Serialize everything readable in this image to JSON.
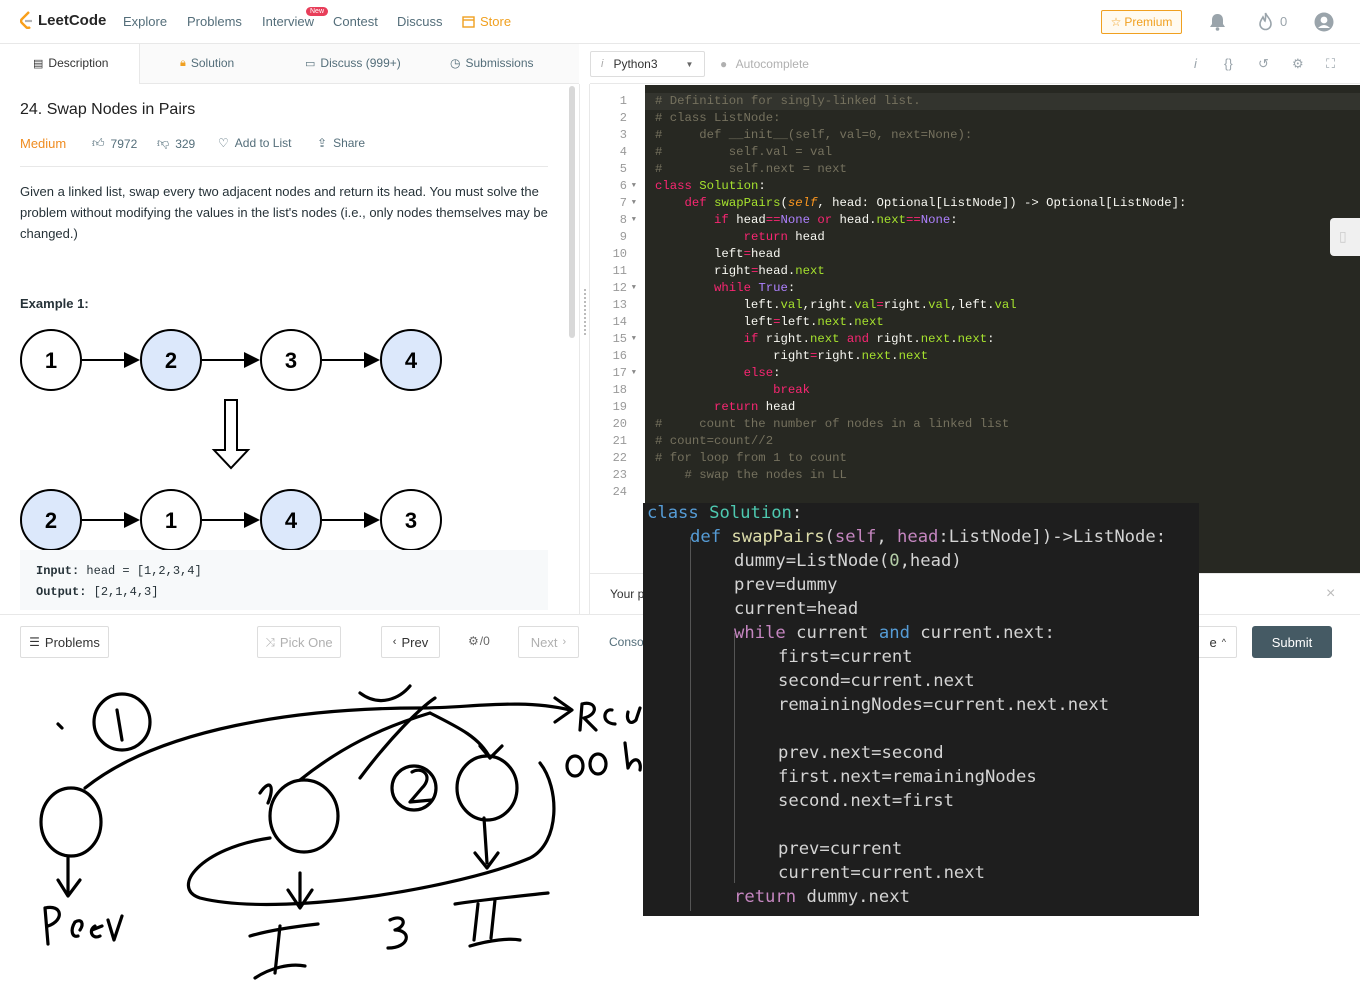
{
  "nav": {
    "logo": "LeetCode",
    "links": [
      "Explore",
      "Problems",
      "Interview",
      "Contest",
      "Discuss",
      "Store"
    ],
    "new_badge": "New",
    "premium": "Premium",
    "coins": "0"
  },
  "left_tabs": {
    "description": "Description",
    "solution": "Solution",
    "discuss": "Discuss (999+)",
    "submissions": "Submissions"
  },
  "problem": {
    "title": "24. Swap Nodes in Pairs",
    "difficulty": "Medium",
    "likes": "7972",
    "dislikes": "329",
    "add_to_list": "Add to List",
    "share": "Share",
    "description": "Given a linked list, swap every two adjacent nodes and return its head. You must solve the problem without modifying the values in the list's nodes (i.e., only nodes themselves may be changed.)",
    "example_title": "Example 1:",
    "diagram_top": [
      "1",
      "2",
      "3",
      "4"
    ],
    "diagram_bottom": [
      "2",
      "1",
      "4",
      "3"
    ],
    "input_label": "Input:",
    "input_value": "head = [1,2,3,4]",
    "output_label": "Output:",
    "output_value": "[2,1,4,3]"
  },
  "editor_toolbar": {
    "language": "Python3",
    "autocomplete": "Autocomplete"
  },
  "editor": {
    "line_numbers": [
      "1",
      "2",
      "3",
      "4",
      "5",
      "6",
      "7",
      "8",
      "9",
      "10",
      "11",
      "12",
      "13",
      "14",
      "15",
      "16",
      "17",
      "18",
      "19",
      "20",
      "21",
      "22",
      "23",
      "24"
    ]
  },
  "console": {
    "partial_text": "Your p"
  },
  "bottom_bar": {
    "problems": "Problems",
    "pick_one": "Pick One",
    "prev": "Prev",
    "page": "/0",
    "next": "Next",
    "console_partial": "Conso",
    "run_partial": "e",
    "submit": "Submit"
  },
  "sketch": {
    "labels": [
      "1",
      "2",
      "3",
      "I",
      "II",
      "Prev",
      "Rem",
      "00"
    ]
  },
  "colors": {
    "accent_orange": "#ef8c21",
    "editor_bg": "#272822",
    "overlay_bg": "#1e1e1e",
    "submit_bg": "#455a64",
    "node_highlight": "#dce8fb"
  }
}
